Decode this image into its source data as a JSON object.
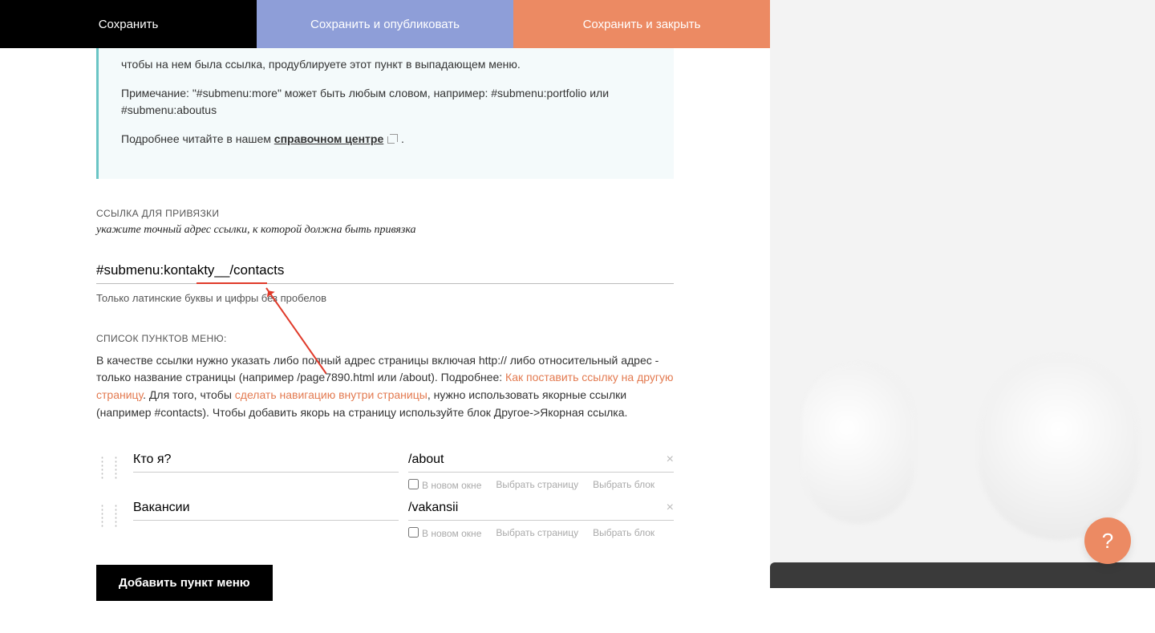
{
  "topbar": {
    "save": "Сохранить",
    "publish": "Сохранить и опубликовать",
    "close": "Сохранить и закрыть"
  },
  "infobox": {
    "p1": "чтобы на нем была ссылка, продублируете этот пункт в выпадающем меню.",
    "p2": "Примечание: \"#submenu:more\" может быть любым словом, например: #submenu:portfolio или #submenu:aboutus",
    "p3_pre": "Подробнее читайте в нашем ",
    "p3_link": "справочном центре",
    "p3_post": " ."
  },
  "link_section": {
    "label": "ССЫЛКА ДЛЯ ПРИВЯЗКИ",
    "subtext": "укажите точный адрес ссылки, к которой должна быть привязка",
    "value": "#submenu:kontakty__/contacts",
    "hint": "Только латинские буквы и цифры без пробелов"
  },
  "menu_section": {
    "label": "СПИСОК ПУНКТОВ МЕНЮ:",
    "desc_pre": "В качестве ссылки нужно указать либо полный адрес страницы включая http:// либо относительный адрес - только название страницы (например /page7890.html или /about). Подробнее: ",
    "desc_link1": "Как поставить ссылку на другую страницу",
    "desc_mid": ". Для того, чтобы ",
    "desc_link2": "сделать навигацию внутри страницы",
    "desc_post": ", нужно использовать якорные ссылки (например #contacts). Чтобы добавить якорь на страницу используйте блок Другое->Якорная ссылка."
  },
  "rows": [
    {
      "name": "Кто я?",
      "link": "/about"
    },
    {
      "name": "Вакансии",
      "link": "/vakansii"
    }
  ],
  "row_opts": {
    "newwin": "В новом окне",
    "choose_page": "Выбрать страницу",
    "choose_block": "Выбрать блок"
  },
  "add_button": "Добавить пункт меню",
  "help": "?"
}
